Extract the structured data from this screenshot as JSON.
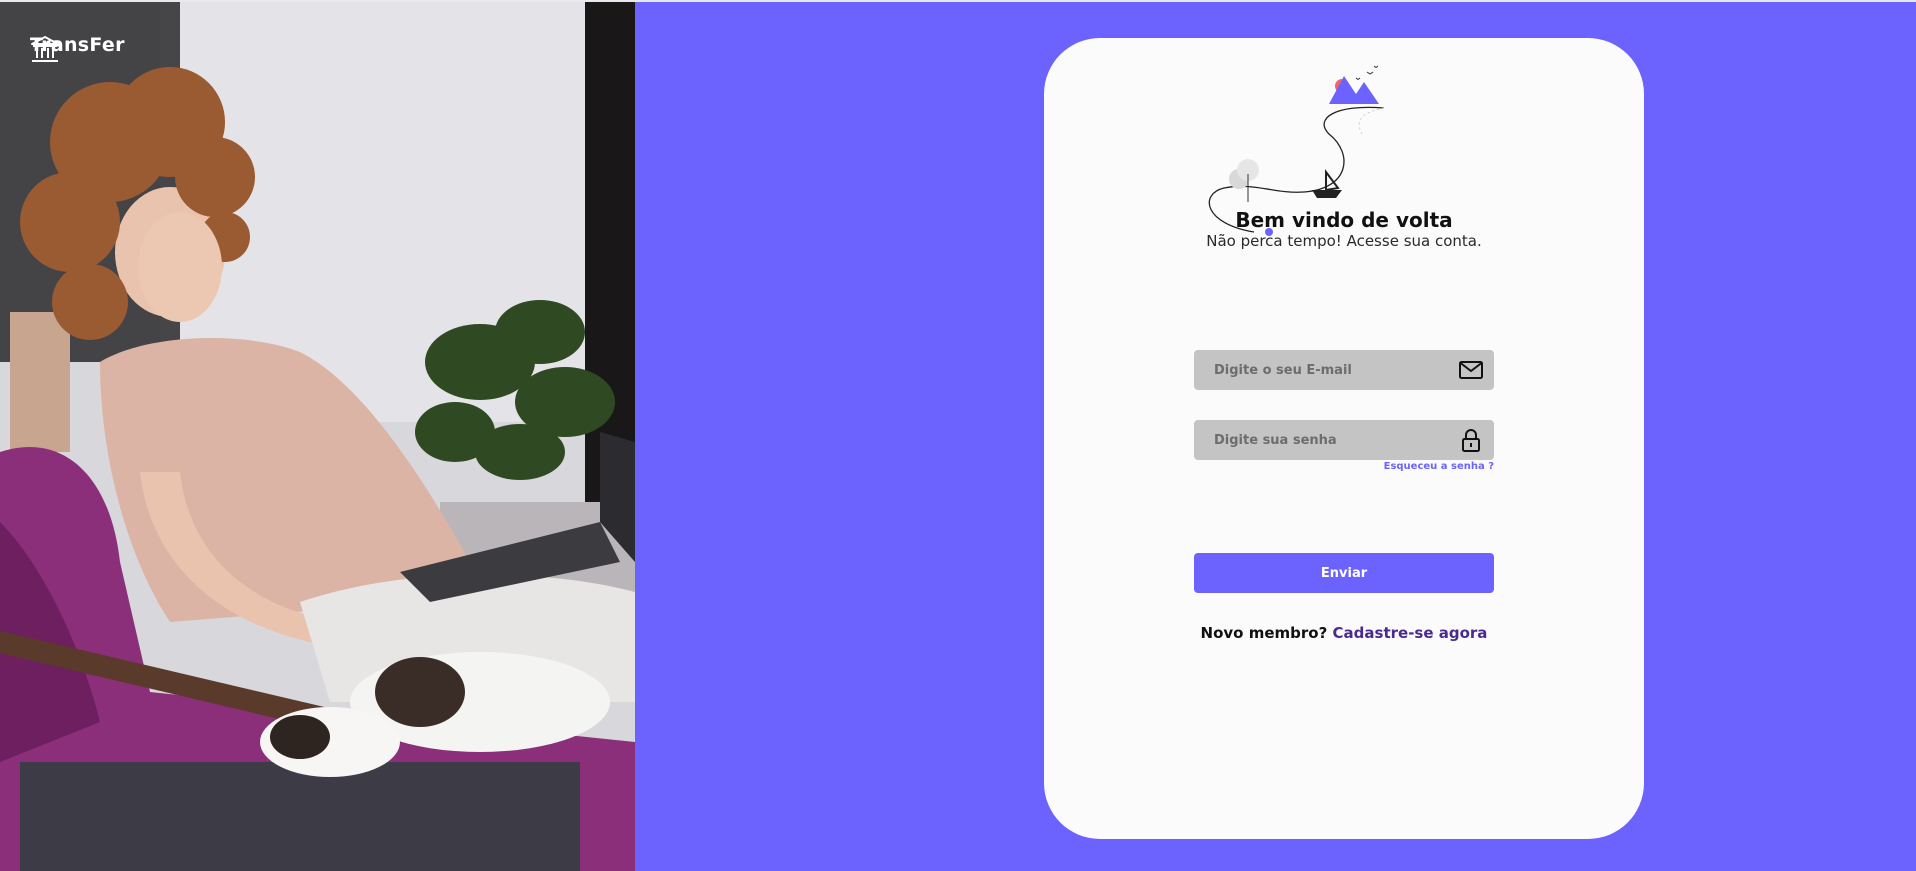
{
  "brand": {
    "name": "TransFer",
    "icon": "bank-building-icon"
  },
  "hero_image": {
    "icon": "photo-woman-with-laptop-and-cat"
  },
  "welcome": {
    "title": "Bem vindo de volta",
    "subtitle": "Não perca tempo! Acesse sua conta."
  },
  "form": {
    "email_placeholder": "Digite o seu E-mail",
    "email_icon": "envelope-icon",
    "password_placeholder": "Digite sua senha",
    "password_icon": "lock-icon",
    "forgot_label": "Esqueceu a senha ?",
    "submit_label": "Enviar"
  },
  "signup": {
    "prompt": "Novo membro?",
    "link_label": "Cadastre-se agora"
  },
  "colors": {
    "accent": "#6c63ff",
    "card_background": "#fcfbfc",
    "field_background": "#c4c4c4",
    "signup_link": "#4b2a8f"
  }
}
